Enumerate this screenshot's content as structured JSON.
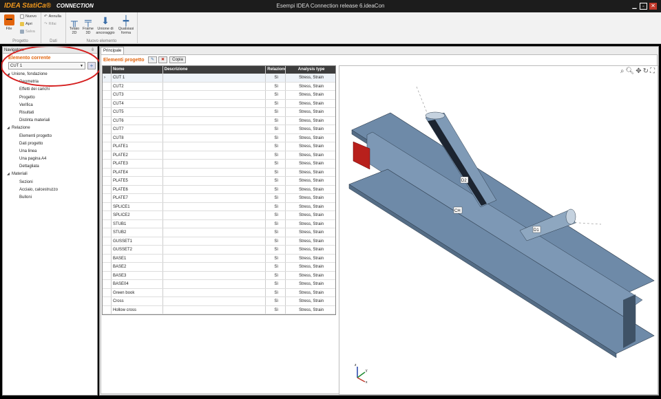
{
  "app": {
    "logo": "IDEA StatiCa®",
    "product": "CONNECTION",
    "title": "Esempi IDEA Connection release 6.ideaCon",
    "minimize_icon": "minimize-icon",
    "restore_icon": "restore-icon",
    "close_icon": "close-icon"
  },
  "ribbon": {
    "file": "File",
    "group_progetto": "Progetto",
    "nuovo": "Nuovo",
    "apri": "Apri",
    "salva": "Salva",
    "annulla": "Annulla",
    "rifai": "Rifai",
    "group_dati": "Dati",
    "telaio2d": "Telaio 2D",
    "frame3d": "Frame 3D",
    "unione": "Unione di ancoraggio",
    "qualsiasi": "Qualsiasi forma",
    "group_nuovo": "Nuovo elemento"
  },
  "nav": {
    "title": "Navigatore",
    "pin": "⇩",
    "section": "Elemento corrente",
    "current": "CUT 1",
    "tree": [
      {
        "label": "Unione, fondazione",
        "level": 0
      },
      {
        "label": "Geometria",
        "level": 1
      },
      {
        "label": "Effetti dei carichi",
        "level": 1
      },
      {
        "label": "Progetto",
        "level": 1
      },
      {
        "label": "Verifica",
        "level": 1
      },
      {
        "label": "Risultati",
        "level": 1
      },
      {
        "label": "Distinta materiali",
        "level": 1
      },
      {
        "label": "Relazione",
        "level": 0
      },
      {
        "label": "Elementi progetto",
        "level": 1
      },
      {
        "label": "Dati progetto",
        "level": 1
      },
      {
        "label": "Una linea",
        "level": 1
      },
      {
        "label": "Una pagina A4",
        "level": 1
      },
      {
        "label": "Dettagliata",
        "level": 1
      },
      {
        "label": "Materiali",
        "level": 0
      },
      {
        "label": "Sezioni",
        "level": 1
      },
      {
        "label": "Acciaio, calcestruzzo",
        "level": 1
      },
      {
        "label": "Bulloni",
        "level": 1
      }
    ]
  },
  "main": {
    "tab": "Principale",
    "header": "Elementi progetto",
    "copy": "Copia",
    "columns": [
      "Nome",
      "Descrizione",
      "Relazione",
      "Analysis type"
    ],
    "rows": [
      [
        "CUT 1",
        "",
        "Sì",
        "Stress, Strain"
      ],
      [
        "CUT2",
        "",
        "Sì",
        "Stress, Strain"
      ],
      [
        "CUT3",
        "",
        "Sì",
        "Stress, Strain"
      ],
      [
        "CUT4",
        "",
        "Sì",
        "Stress, Strain"
      ],
      [
        "CUT5",
        "",
        "Sì",
        "Stress, Strain"
      ],
      [
        "CUT6",
        "",
        "Sì",
        "Stress, Strain"
      ],
      [
        "CUT7",
        "",
        "Sì",
        "Stress, Strain"
      ],
      [
        "CUT8",
        "",
        "Sì",
        "Stress, Strain"
      ],
      [
        "PLATE1",
        "",
        "Sì",
        "Stress, Strain"
      ],
      [
        "PLATE2",
        "",
        "Sì",
        "Stress, Strain"
      ],
      [
        "PLATE3",
        "",
        "Sì",
        "Stress, Strain"
      ],
      [
        "PLATE4",
        "",
        "Sì",
        "Stress, Strain"
      ],
      [
        "PLATE5",
        "",
        "Sì",
        "Stress, Strain"
      ],
      [
        "PLATE6",
        "",
        "Sì",
        "Stress, Strain"
      ],
      [
        "PLATE7",
        "",
        "Sì",
        "Stress, Strain"
      ],
      [
        "SPLICE1",
        "",
        "Sì",
        "Stress, Strain"
      ],
      [
        "SPLICE2",
        "",
        "Sì",
        "Stress, Strain"
      ],
      [
        "STUB1",
        "",
        "Sì",
        "Stress, Strain"
      ],
      [
        "STUB2",
        "",
        "Sì",
        "Stress, Strain"
      ],
      [
        "GUSSET1",
        "",
        "Sì",
        "Stress, Strain"
      ],
      [
        "GUSSET2",
        "",
        "Sì",
        "Stress, Strain"
      ],
      [
        "BASE1",
        "",
        "Sì",
        "Stress, Strain"
      ],
      [
        "BASE2",
        "",
        "Sì",
        "Stress, Strain"
      ],
      [
        "BASE3",
        "",
        "Sì",
        "Stress, Strain"
      ],
      [
        "BASE04",
        "",
        "Sì",
        "Stress, Strain"
      ],
      [
        "Green book",
        "",
        "Sì",
        "Stress, Strain"
      ],
      [
        "Cross",
        "",
        "Sì",
        "Stress, Strain"
      ],
      [
        "Hollow cross",
        "",
        "Sì",
        "Stress, Strain"
      ]
    ],
    "model": {
      "labels": {
        "ch": "CH",
        "d1": "D1",
        "d2": "D2"
      },
      "axes": {
        "x": "x",
        "y": "y",
        "z": "z"
      },
      "steel_color": "#6e8aa8"
    }
  }
}
